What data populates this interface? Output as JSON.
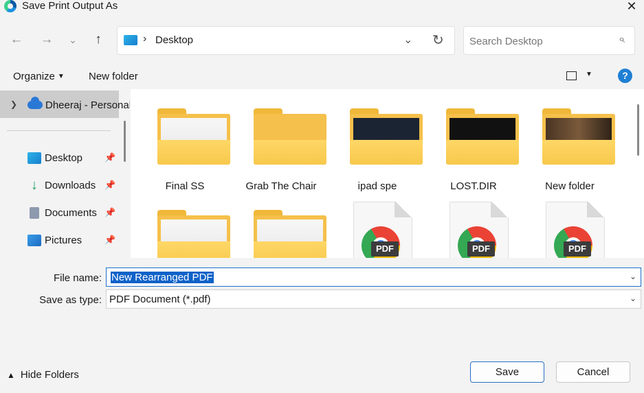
{
  "window": {
    "title": "Save Print Output As",
    "close_glyph": "✕"
  },
  "nav": {
    "back_glyph": "←",
    "forward_glyph": "→",
    "recent_glyph": "⌄",
    "up_glyph": "↑",
    "address": {
      "separator": "›",
      "location": "Desktop",
      "dropdown_glyph": "⌄",
      "refresh_glyph": "↻"
    },
    "search": {
      "placeholder": "Search Desktop",
      "value": ""
    }
  },
  "toolbar": {
    "organize_label": "Organize",
    "new_folder_label": "New folder",
    "help_glyph": "?"
  },
  "sidebar": {
    "user_label": "Dheeraj - Personal",
    "items": [
      {
        "label": "Desktop",
        "icon": "desktop-icon"
      },
      {
        "label": "Downloads",
        "icon": "downloads-icon"
      },
      {
        "label": "Documents",
        "icon": "documents-icon"
      },
      {
        "label": "Pictures",
        "icon": "pictures-icon"
      }
    ],
    "pin_glyph": "📌"
  },
  "content": {
    "items": [
      {
        "label": "Final SS",
        "type": "folder"
      },
      {
        "label": "Grab The Chair",
        "type": "folder"
      },
      {
        "label": "ipad spe",
        "type": "folder"
      },
      {
        "label": "LOST.DIR",
        "type": "folder"
      },
      {
        "label": "New folder",
        "type": "folder"
      },
      {
        "label": "",
        "type": "folder"
      },
      {
        "label": "",
        "type": "folder"
      },
      {
        "label": "",
        "type": "pdf",
        "badge": "PDF"
      },
      {
        "label": "",
        "type": "pdf",
        "badge": "PDF"
      },
      {
        "label": "",
        "type": "pdf",
        "badge": "PDF"
      }
    ]
  },
  "form": {
    "file_name_label": "File name:",
    "file_name_value": "New Rearranged PDF",
    "save_type_label": "Save as type:",
    "save_type_value": "PDF Document (*.pdf)"
  },
  "footer": {
    "hide_folders_label": "Hide Folders",
    "save_label": "Save",
    "cancel_label": "Cancel"
  }
}
